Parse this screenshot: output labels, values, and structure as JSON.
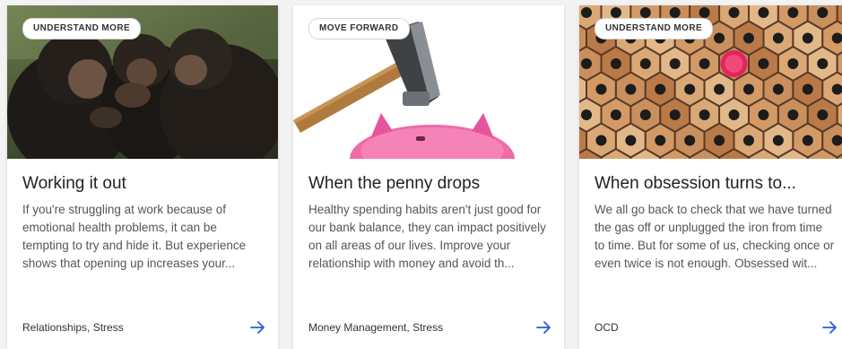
{
  "colors": {
    "accent": "#2a5bd7",
    "card_bg": "#ffffff",
    "page_bg": "#f3f3f3"
  },
  "cards": [
    {
      "badge": "UNDERSTAND MORE",
      "title": "Working it out",
      "description": "If you're struggling at work because of emotional health problems, it can be tempting to try and hide it. But experience shows that opening up increases your...",
      "tags": "Relationships, Stress",
      "image_icon": "chimpanzees-photo",
      "link_icon": "arrow-right-icon"
    },
    {
      "badge": "MOVE FORWARD",
      "title": "When the penny drops",
      "description": "Healthy spending habits aren't just good for our bank balance, they can impact positively on all areas of our lives. Improve your relationship with money and avoid th...",
      "tags": "Money Management, Stress",
      "image_icon": "hammer-piggy-bank-photo",
      "link_icon": "arrow-right-icon"
    },
    {
      "badge": "UNDERSTAND MORE",
      "title": "When obsession turns to...",
      "description": "We all go back to check that we have turned the gas off or unplugged the iron from time to time. But for some of us, checking once or even twice is not enough. Obsessed wit...",
      "tags": "OCD",
      "image_icon": "pencils-pattern-photo",
      "link_icon": "arrow-right-icon"
    }
  ]
}
